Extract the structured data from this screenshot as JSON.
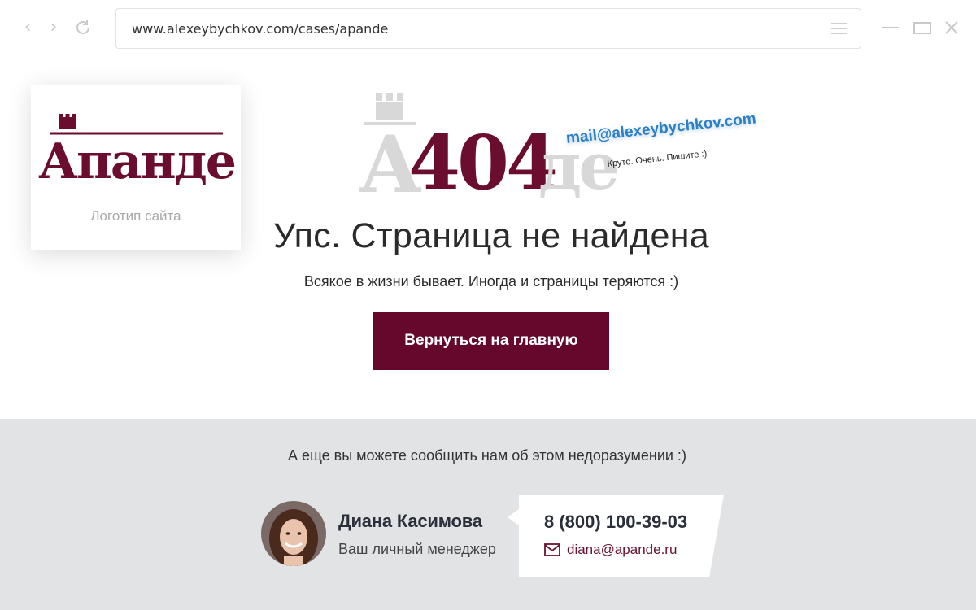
{
  "browser": {
    "url": "www.alexeybychkov.com/cases/apande"
  },
  "logo_card": {
    "logo_text": "Апанде",
    "caption": "Логотип сайта"
  },
  "hero": {
    "art_text": "А404де",
    "annotation_email": "mail@alexeybychkov.com",
    "annotation_note": "Круто. Очень. Пишите :)",
    "title": "Упс. Страница не найдена",
    "subtitle": "Всякое в жизни бывает. Иногда и страницы теряются :)",
    "button_label": "Вернуться на главную"
  },
  "footer": {
    "text": "А еще вы можете сообщить нам об этом недоразумении :)",
    "manager_name": "Диана Касимова",
    "manager_role": "Ваш личный менеджер",
    "phone": "8 (800) 100-39-03",
    "email": "diana@apande.ru"
  },
  "colors": {
    "brand": "#65082c",
    "footer_bg": "#e2e3e5",
    "annotation": "#2d7fc6"
  }
}
